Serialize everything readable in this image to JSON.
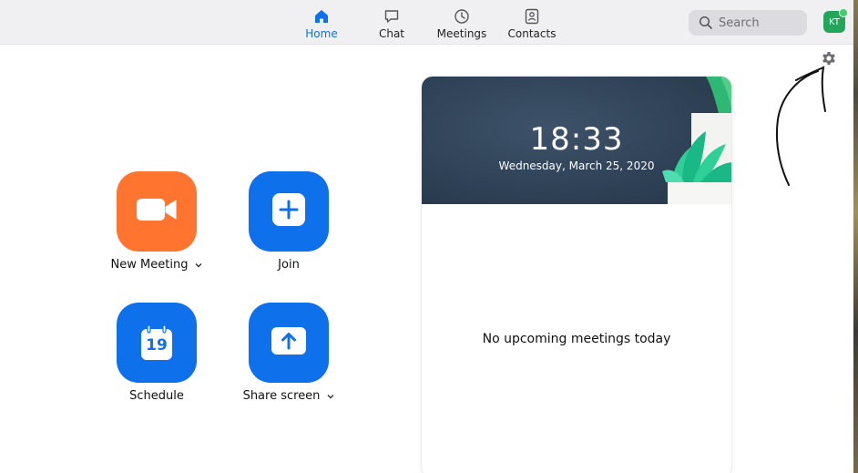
{
  "nav": {
    "tabs": [
      {
        "label": "Home",
        "icon": "home-icon",
        "active": true
      },
      {
        "label": "Chat",
        "icon": "chat-bubble-icon",
        "active": false
      },
      {
        "label": "Meetings",
        "icon": "clock-icon",
        "active": false
      },
      {
        "label": "Contacts",
        "icon": "contact-card-icon",
        "active": false
      }
    ]
  },
  "search": {
    "placeholder": "Search"
  },
  "user": {
    "initials": "KT",
    "status": "online"
  },
  "actions": {
    "new_meeting": "New Meeting",
    "join": "Join",
    "schedule": "Schedule",
    "schedule_day": "19",
    "share_screen": "Share screen"
  },
  "panel": {
    "time": "18:33",
    "date": "Wednesday, March 25, 2020",
    "empty_message": "No upcoming meetings today"
  },
  "colors": {
    "accent": "#0e71eb",
    "new_meeting": "#ff742e",
    "avatar": "#23a55a",
    "header_bg": "#2c3e52"
  }
}
